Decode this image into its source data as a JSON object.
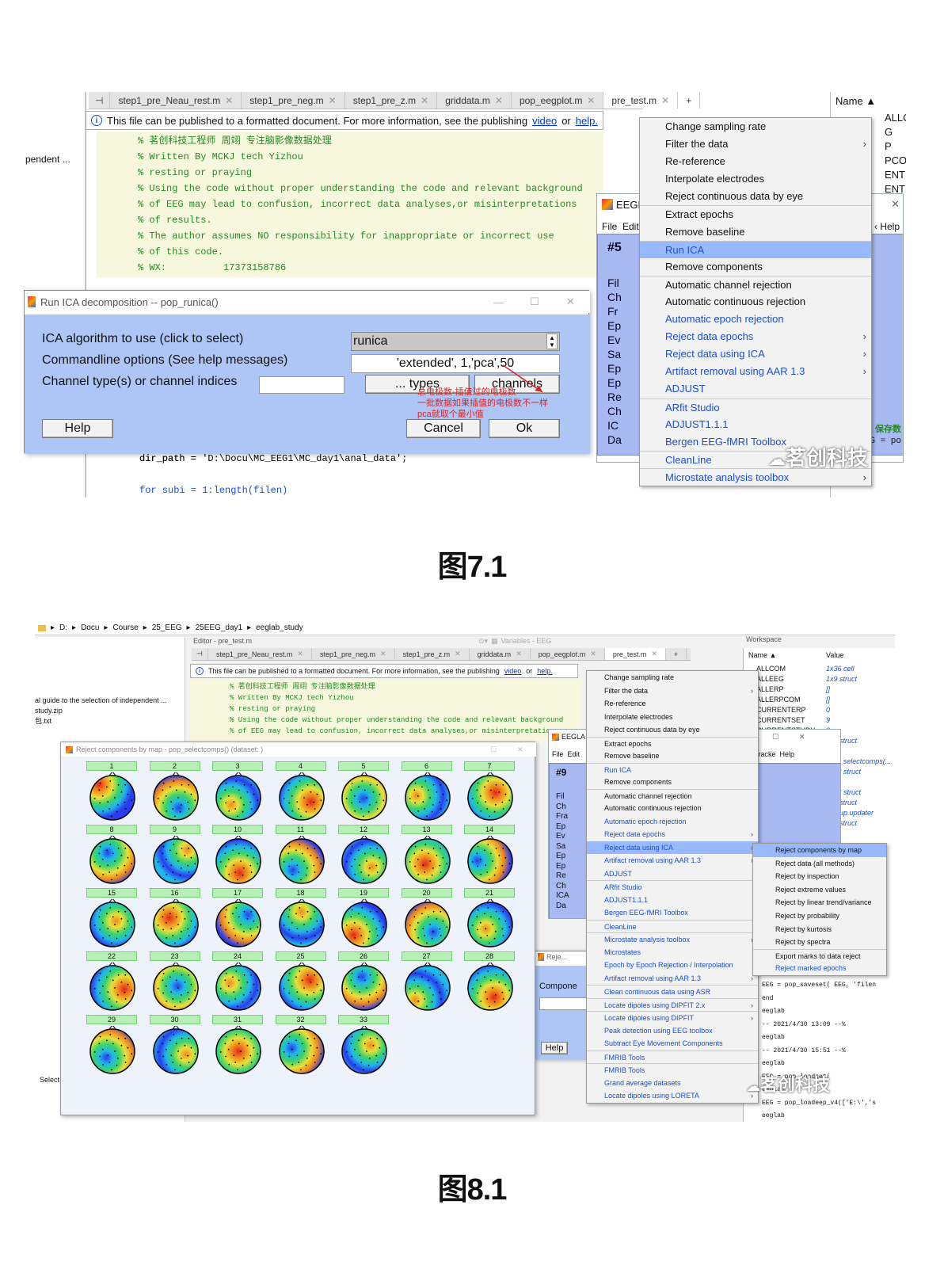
{
  "fig1": {
    "caption": "图7.1",
    "tabs": [
      {
        "label": "step1_pre_Neau_rest.m"
      },
      {
        "label": "step1_pre_neg.m"
      },
      {
        "label": "step1_pre_z.m"
      },
      {
        "label": "griddata.m"
      },
      {
        "label": "pop_eegplot.m"
      },
      {
        "label": "pre_test.m"
      }
    ],
    "tab_add": "+",
    "info": {
      "text": "This file can be published to a formatted document. For more information, see the publishing",
      "video": "video",
      "or": "or",
      "help": "help."
    },
    "left_panel_text": "pendent ...",
    "workspace_header": "Name ▲",
    "workspace_items": [
      "ALLCOM",
      "G",
      "P",
      "PCOM",
      "ENTER",
      "ENTSET"
    ],
    "code_lines": [
      "% 茗创科技工程师 周翊 专注脑影像数据处理",
      "% Written By MCKJ tech Yizhou",
      "% resting or praying",
      "% Using the code without proper understanding the code and relevant background",
      "% of EEG may lead to confusion, incorrect data analyses,or misinterpretations",
      "% of results.",
      "% The author assumes NO responsibility for inappropriate or incorrect use",
      "% of this code.",
      "% WX:          17373158786"
    ],
    "code_bottom": "dir_path = 'D:\\Docu\\MC_EEG1\\MC_day1\\anal_data';",
    "code_bottom2": "for subi = 1:length(filen)",
    "eeglab": {
      "title": "EEGL",
      "menu": "File  Edit",
      "hash": "#5",
      "help": "Help",
      "side_letters": [
        "Fil",
        "Ch",
        "Fr",
        "Ep",
        "Ev",
        "Sa",
        "Ep",
        "Ep",
        "Re",
        "Ch",
        "IC",
        "Da"
      ],
      "green_text": "保存数",
      "g_line": "G = po"
    },
    "dialog": {
      "title": "Run ICA decomposition -- pop_runica()",
      "label_algo": "ICA algorithm to use (click to select)",
      "label_cmd": "Commandline options (See help messages)",
      "label_chan": "Channel type(s) or channel indices",
      "algo_value": "runica",
      "cmd_value": "'extended', 1,'pca',50",
      "btn_types": "... types",
      "btn_channels": "channels",
      "btn_help": "Help",
      "btn_cancel": "Cancel",
      "btn_ok": "Ok",
      "annotation": [
        "总电极数-插值过的电极数",
        "一批数据如果插值的电极数不一样",
        "pca就取个最小值"
      ]
    },
    "menu": [
      {
        "label": "Change sampling rate",
        "blue": false,
        "arrow": false,
        "sep": false
      },
      {
        "label": "Filter the data",
        "blue": false,
        "arrow": true,
        "sep": false
      },
      {
        "label": "Re-reference",
        "blue": false,
        "arrow": false,
        "sep": false
      },
      {
        "label": "Interpolate electrodes",
        "blue": false,
        "arrow": false,
        "sep": false
      },
      {
        "label": "Reject continuous data by eye",
        "blue": false,
        "arrow": false,
        "sep": false
      },
      {
        "label": "Extract epochs",
        "blue": false,
        "arrow": false,
        "sep": true
      },
      {
        "label": "Remove baseline",
        "blue": false,
        "arrow": false,
        "sep": false
      },
      {
        "label": "Run ICA",
        "blue": true,
        "arrow": false,
        "sep": true,
        "selected": true
      },
      {
        "label": "Remove components",
        "blue": false,
        "arrow": false,
        "sep": false
      },
      {
        "label": "Automatic channel rejection",
        "blue": false,
        "arrow": false,
        "sep": true
      },
      {
        "label": "Automatic continuous rejection",
        "blue": false,
        "arrow": false,
        "sep": false
      },
      {
        "label": "Automatic epoch rejection",
        "blue": true,
        "arrow": false,
        "sep": false
      },
      {
        "label": "Reject data epochs",
        "blue": true,
        "arrow": true,
        "sep": false
      },
      {
        "label": "Reject data using ICA",
        "blue": true,
        "arrow": true,
        "sep": false
      },
      {
        "label": "Artifact removal using AAR 1.3",
        "blue": true,
        "arrow": true,
        "sep": false
      },
      {
        "label": "ADJUST",
        "blue": true,
        "arrow": false,
        "sep": false
      },
      {
        "label": "ARfit Studio",
        "blue": true,
        "arrow": false,
        "sep": true
      },
      {
        "label": "ADJUST1.1.1",
        "blue": true,
        "arrow": false,
        "sep": false
      },
      {
        "label": "Bergen EEG-fMRI Toolbox",
        "blue": true,
        "arrow": false,
        "sep": false
      },
      {
        "label": "CleanLine",
        "blue": true,
        "arrow": false,
        "sep": true
      },
      {
        "label": "Microstate analysis toolbox",
        "blue": true,
        "arrow": true,
        "sep": true
      }
    ],
    "watermark": "茗创科技"
  },
  "fig2": {
    "caption": "图8.1",
    "breadcrumb": [
      "D:",
      "Docu",
      "Course",
      "25_EEG",
      "25EEG_day1",
      "eeglab_study"
    ],
    "editor_title": "Editor - pre_test.m",
    "variables_title": "Variables - EEG",
    "workspace_title": "Workspace",
    "left_files": [
      "al guide to the selection of independent ...",
      "study.zip",
      "包.txt"
    ],
    "select_label": "Select",
    "tabs": [
      {
        "label": "step1_pre_Neau_rest.m"
      },
      {
        "label": "step1_pre_neg.m"
      },
      {
        "label": "step1_pre_z.m"
      },
      {
        "label": "griddata.m"
      },
      {
        "label": "pop_eegplot.m"
      },
      {
        "label": "pre_test.m"
      }
    ],
    "info": {
      "text": "This file can be published to a formatted document. For more information, see the publishing",
      "video": "video",
      "or": "or",
      "help": "help."
    },
    "code_lines": [
      "% 茗创科技工程师 周翊 专注脑影像数据处理",
      "% Written By MCKJ tech Yizhou",
      "% resting or praying",
      "% Using the code without proper understanding the code and relevant background",
      "% of EEG may lead to confusion, incorrect data analyses,or misinterpretations"
    ],
    "comp_window": {
      "title": "Reject components by map - pop_selectcomps() (dataset: )",
      "labels": [
        "1",
        "2",
        "3",
        "4",
        "5",
        "6",
        "7",
        "8",
        "9",
        "10",
        "11",
        "12",
        "13",
        "14",
        "15",
        "16",
        "17",
        "18",
        "19",
        "20",
        "21",
        "22",
        "23",
        "24",
        "25",
        "26",
        "27",
        "28",
        "29",
        "30",
        "31",
        "32",
        "33"
      ]
    },
    "ws_header": {
      "name": "Name ▲",
      "value": "Value"
    },
    "ws_rows": [
      {
        "name": "ALLCOM",
        "value": "1x36 cell"
      },
      {
        "name": "ALLEEG",
        "value": "1x9 struct"
      },
      {
        "name": "ALLERP",
        "value": "[]"
      },
      {
        "name": "ALLERPCOM",
        "value": "[]"
      },
      {
        "name": "CURRENTERP",
        "value": "0"
      },
      {
        "name": "CURRENTSET",
        "value": "9"
      },
      {
        "name": "CURRENTSTUDY",
        "value": "0"
      },
      {
        "name": "",
        "value": "1x1 struct"
      },
      {
        "name": "",
        "value": "[]"
      },
      {
        "name": "",
        "value": "'pop_selectcomps(..."
      },
      {
        "name": "",
        "value": "1x53 struct"
      },
      {
        "name": "",
        "value": "[]"
      },
      {
        "name": "",
        "value": "1x63 struct"
      },
      {
        "name": "",
        "value": "1x1 struct"
      },
      {
        "name": "",
        "value": "1x1 up.updater"
      },
      {
        "name": "",
        "value": "1x1 struct"
      }
    ],
    "eeglab": {
      "title": "EEGLA",
      "menu": "File  Edit",
      "hash": "#9",
      "side_letters": [
        "Fil",
        "Ch",
        "Fra",
        "Ep",
        "Ev",
        "Sa",
        "Ep",
        "Ep",
        "Re",
        "Ch",
        "ICA",
        "Da"
      ],
      "tracke_help": "tracke  Help"
    },
    "small_dialog": {
      "title": "Reje...",
      "label": "Compone",
      "help": "Help"
    },
    "menu": [
      {
        "label": "Change sampling rate",
        "blue": false,
        "arrow": false,
        "sep": false
      },
      {
        "label": "Filter the data",
        "blue": false,
        "arrow": true,
        "sep": false
      },
      {
        "label": "Re-reference",
        "blue": false,
        "arrow": false,
        "sep": false
      },
      {
        "label": "Interpolate electrodes",
        "blue": false,
        "arrow": false,
        "sep": false
      },
      {
        "label": "Reject continuous data by eye",
        "blue": false,
        "arrow": false,
        "sep": false
      },
      {
        "label": "Extract epochs",
        "blue": false,
        "arrow": false,
        "sep": true
      },
      {
        "label": "Remove baseline",
        "blue": false,
        "arrow": false,
        "sep": false
      },
      {
        "label": "Run ICA",
        "blue": true,
        "arrow": false,
        "sep": true
      },
      {
        "label": "Remove components",
        "blue": false,
        "arrow": false,
        "sep": false
      },
      {
        "label": "Automatic channel rejection",
        "blue": false,
        "arrow": false,
        "sep": true
      },
      {
        "label": "Automatic continuous rejection",
        "blue": false,
        "arrow": false,
        "sep": false
      },
      {
        "label": "Automatic epoch rejection",
        "blue": true,
        "arrow": false,
        "sep": false
      },
      {
        "label": "Reject data epochs",
        "blue": true,
        "arrow": true,
        "sep": false
      },
      {
        "label": "Reject data using ICA",
        "blue": true,
        "arrow": true,
        "sep": false,
        "selected": true
      },
      {
        "label": "Artifact removal using AAR 1.3",
        "blue": true,
        "arrow": true,
        "sep": false
      },
      {
        "label": "ADJUST",
        "blue": true,
        "arrow": false,
        "sep": false
      },
      {
        "label": "ARfit Studio",
        "blue": true,
        "arrow": false,
        "sep": true
      },
      {
        "label": "ADJUST1.1.1",
        "blue": true,
        "arrow": false,
        "sep": false
      },
      {
        "label": "Bergen EEG-fMRI Toolbox",
        "blue": true,
        "arrow": false,
        "sep": false
      },
      {
        "label": "CleanLine",
        "blue": true,
        "arrow": false,
        "sep": true
      },
      {
        "label": "Microstate analysis toolbox",
        "blue": true,
        "arrow": true,
        "sep": true
      },
      {
        "label": "Microstates",
        "blue": true,
        "arrow": false,
        "sep": false
      },
      {
        "label": "Epoch by Epoch Rejection / Interpolation",
        "blue": true,
        "arrow": false,
        "sep": false
      },
      {
        "label": "Artifact removal using AAR 1.3",
        "blue": true,
        "arrow": true,
        "sep": false
      },
      {
        "label": "Clean continuous data using ASR",
        "blue": true,
        "arrow": false,
        "sep": true
      },
      {
        "label": "Locate dipoles using DIPFIT 2.x",
        "blue": true,
        "arrow": true,
        "sep": true
      },
      {
        "label": "Locate dipoles using DIPFIT",
        "blue": true,
        "arrow": true,
        "sep": true
      },
      {
        "label": "Peak detection using EEG toolbox",
        "blue": true,
        "arrow": false,
        "sep": false
      },
      {
        "label": "Subtract Eye Movement Components",
        "blue": true,
        "arrow": false,
        "sep": false
      },
      {
        "label": "FMRIB Tools",
        "blue": true,
        "arrow": false,
        "sep": true
      },
      {
        "label": "FMRIB Tools",
        "blue": true,
        "arrow": false,
        "sep": true
      },
      {
        "label": "Grand average datasets",
        "blue": true,
        "arrow": false,
        "sep": false
      },
      {
        "label": "Locate dipoles using LORETA",
        "blue": true,
        "arrow": true,
        "sep": false
      }
    ],
    "submenu": [
      {
        "label": "Reject components by map",
        "selected": true,
        "blue": false,
        "sep": false
      },
      {
        "label": "Reject data (all methods)",
        "blue": false,
        "sep": false
      },
      {
        "label": "Reject by inspection",
        "blue": false,
        "sep": false
      },
      {
        "label": "Reject extreme values",
        "blue": false,
        "sep": false
      },
      {
        "label": "Reject by linear trend/variance",
        "blue": false,
        "sep": false
      },
      {
        "label": "Reject by probability",
        "blue": false,
        "sep": false
      },
      {
        "label": "Reject by kurtosis",
        "blue": false,
        "sep": false
      },
      {
        "label": "Reject by spectra",
        "blue": false,
        "sep": false
      },
      {
        "label": "Export marks to data reject",
        "blue": false,
        "sep": true
      },
      {
        "label": "Reject marked epochs",
        "blue": true,
        "sep": false
      }
    ],
    "cmd_lines": [
      "EEG = pop_saveset( EEG, 'filen",
      "end",
      "eeglab",
      "-- 2021/4/30 13:09 --%",
      "eeglab",
      "-- 2021/4/30 15:51 --%",
      "eeglab",
      "EEG = pop_loadset(",
      "eeglab",
      "EEG = pop_loadeep_v4(['E:\\','s",
      "eeglab"
    ],
    "watermark": "茗创科技"
  }
}
